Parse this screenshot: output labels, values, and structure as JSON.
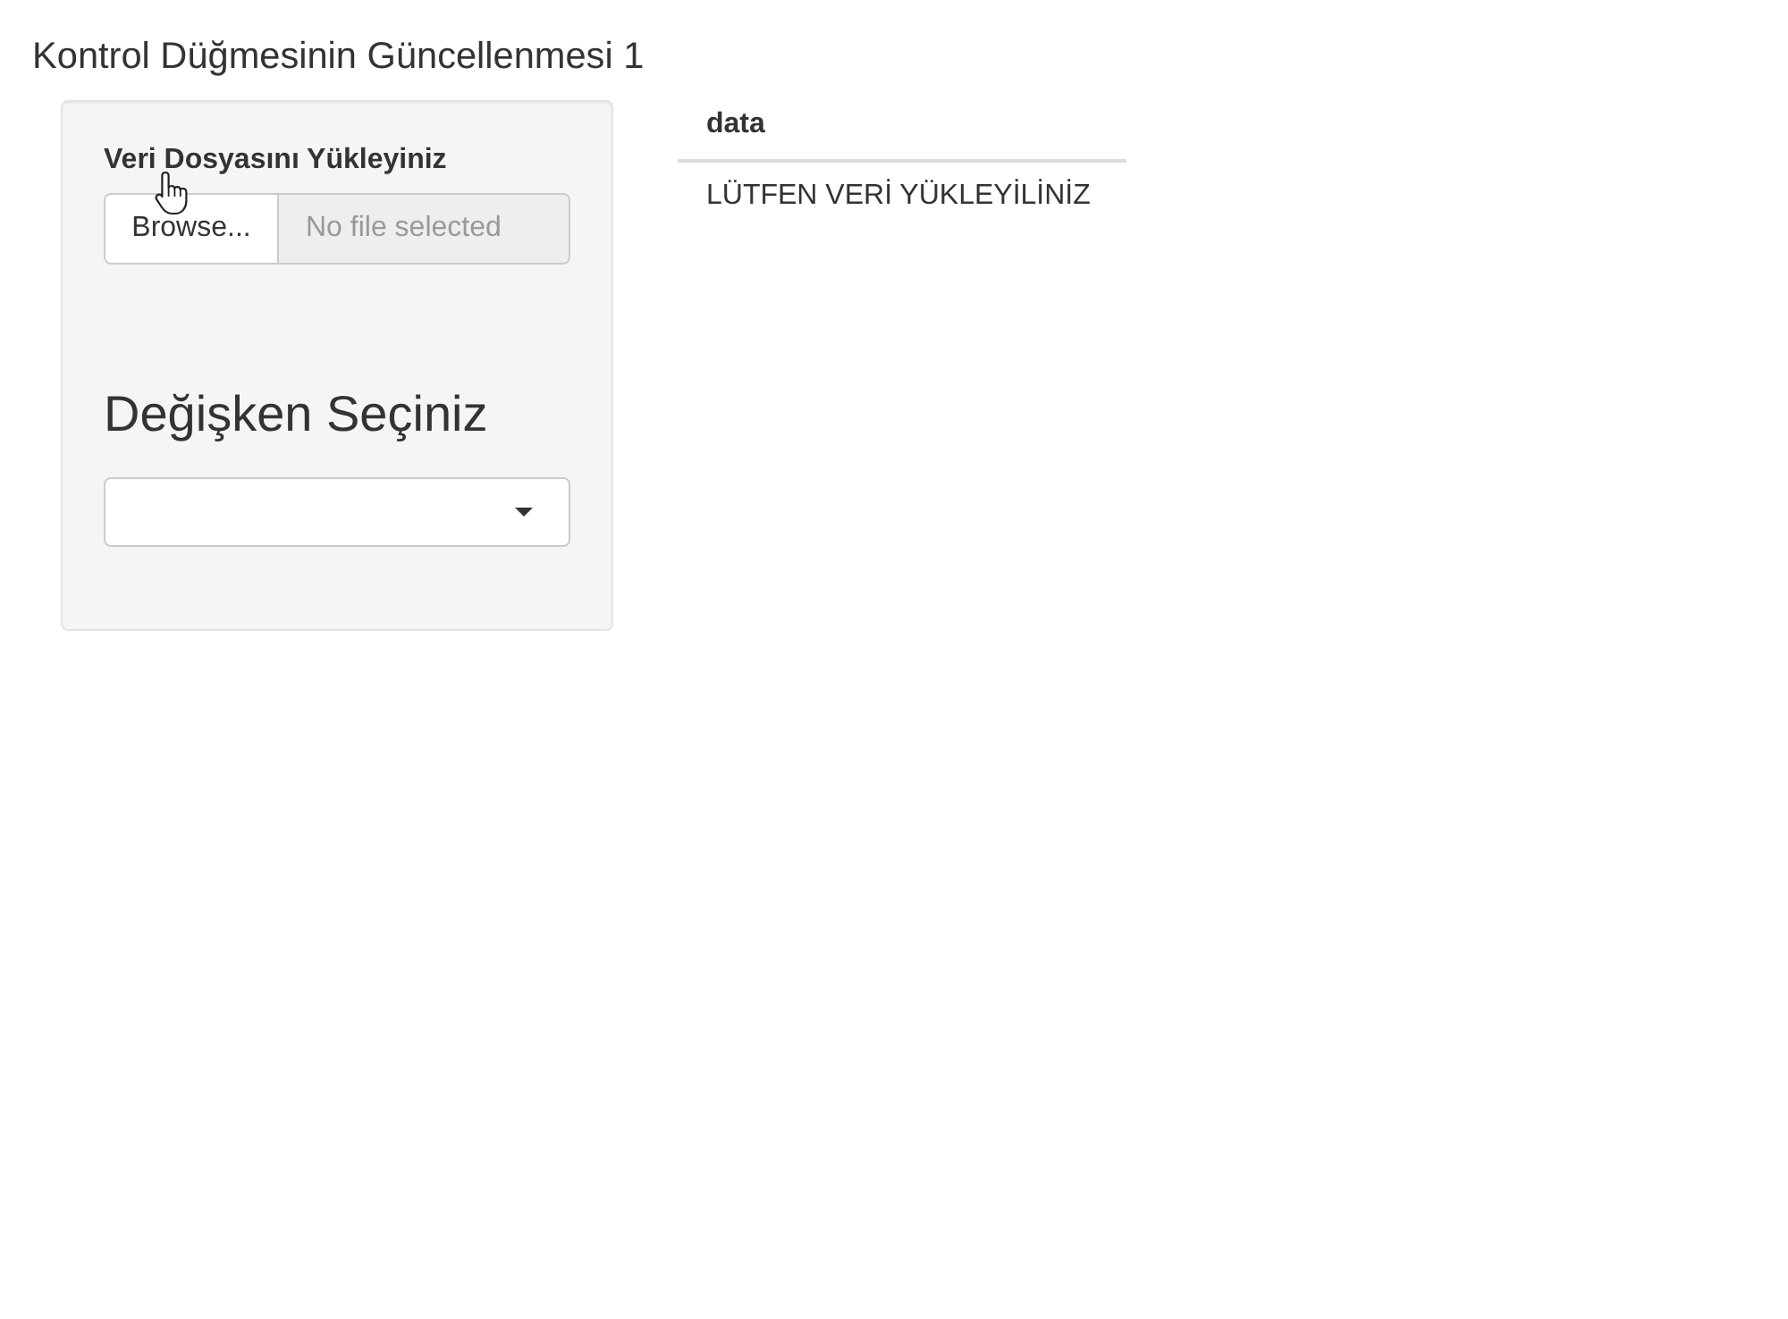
{
  "title": "Kontrol Düğmesinin Güncellenmesi 1",
  "sidebar": {
    "file_input": {
      "label": "Veri Dosyasını Yükleyiniz",
      "button": "Browse...",
      "placeholder": "No file selected"
    },
    "variable_select": {
      "label": "Değişken Seçiniz"
    }
  },
  "table": {
    "columns": [
      "data"
    ],
    "rows": [
      [
        "LÜTFEN VERİ YÜKLEYİLİNİZ"
      ]
    ]
  }
}
